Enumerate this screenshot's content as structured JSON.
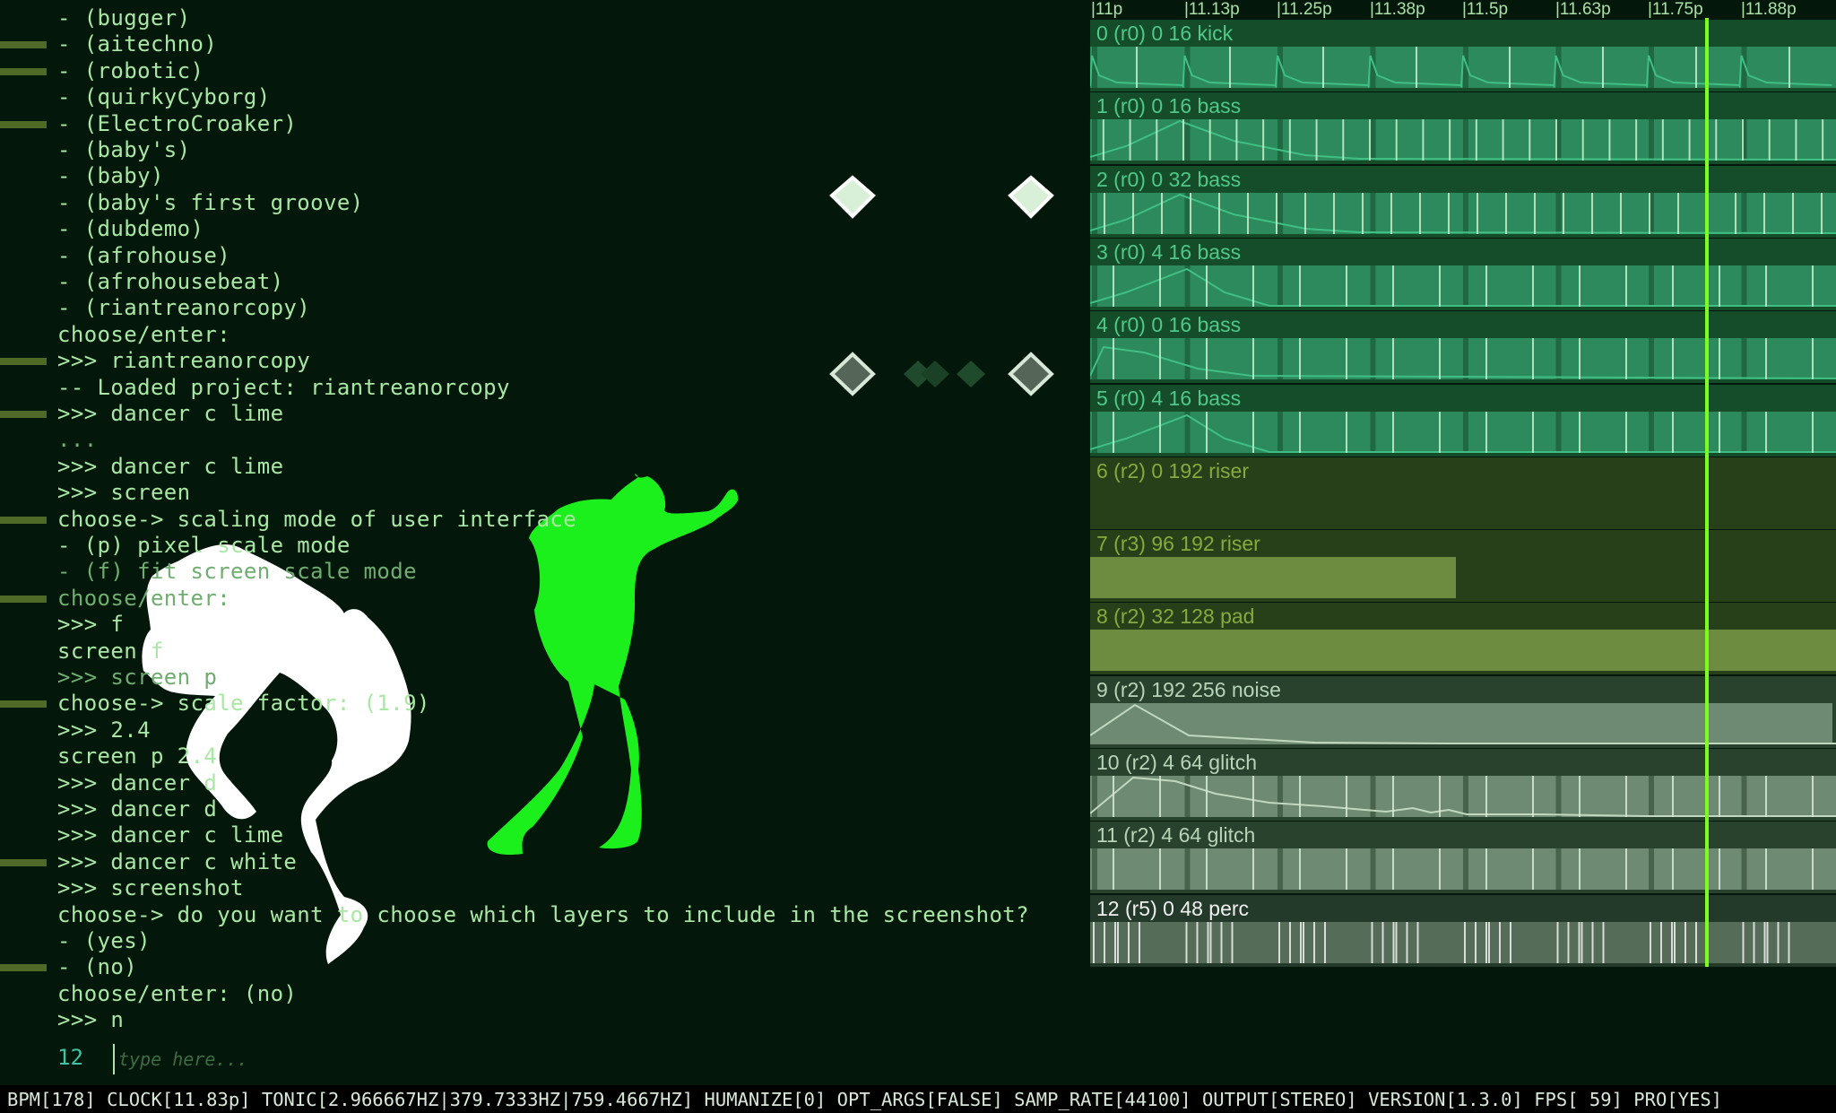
{
  "console": {
    "lines": [
      {
        "text": "- (bugger)",
        "mark": false,
        "dim": false
      },
      {
        "text": "- (aitechno)",
        "mark": true,
        "dim": false
      },
      {
        "text": "- (robotic)",
        "mark": true,
        "dim": false
      },
      {
        "text": "- (quirkyCyborg)",
        "mark": false,
        "dim": false
      },
      {
        "text": "- (ElectroCroaker)",
        "mark": true,
        "dim": false
      },
      {
        "text": "- (baby's)",
        "mark": false,
        "dim": false
      },
      {
        "text": "- (baby)",
        "mark": false,
        "dim": false
      },
      {
        "text": "- (baby's first groove)",
        "mark": false,
        "dim": false
      },
      {
        "text": "- (dubdemo)",
        "mark": false,
        "dim": false
      },
      {
        "text": "- (afrohouse)",
        "mark": false,
        "dim": false
      },
      {
        "text": "- (afrohousebeat)",
        "mark": false,
        "dim": false
      },
      {
        "text": "- (riantreanorcopy)",
        "mark": false,
        "dim": false
      },
      {
        "text": "choose/enter:",
        "mark": false,
        "dim": false
      },
      {
        "text": ">>> riantreanorcopy",
        "mark": true,
        "dim": false
      },
      {
        "text": "-- Loaded project: riantreanorcopy",
        "mark": false,
        "dim": false
      },
      {
        "text": ">>> dancer c lime",
        "mark": true,
        "dim": false
      },
      {
        "text": "...",
        "mark": false,
        "dim": true
      },
      {
        "text": ">>> dancer c lime",
        "mark": false,
        "dim": false
      },
      {
        "text": ">>> screen",
        "mark": false,
        "dim": false
      },
      {
        "text": "choose-> scaling mode of user interface",
        "mark": true,
        "dim": false
      },
      {
        "text": "- (p) pixel scale mode",
        "mark": false,
        "dim": false
      },
      {
        "text": "- (f) fit screen scale mode",
        "mark": false,
        "dim": true
      },
      {
        "text": "choose/enter:",
        "mark": true,
        "dim": true
      },
      {
        "text": ">>> f",
        "mark": false,
        "dim": false
      },
      {
        "text": "screen f",
        "mark": false,
        "dim": false
      },
      {
        "text": ">>> screen p",
        "mark": false,
        "dim": true
      },
      {
        "text": "choose-> scale factor: (1.9)",
        "mark": true,
        "dim": false
      },
      {
        "text": ">>> 2.4",
        "mark": false,
        "dim": false
      },
      {
        "text": "screen p 2.4",
        "mark": false,
        "dim": false
      },
      {
        "text": ">>> dancer d",
        "mark": false,
        "dim": false
      },
      {
        "text": ">>> dancer d",
        "mark": false,
        "dim": false
      },
      {
        "text": ">>> dancer c lime",
        "mark": false,
        "dim": false
      },
      {
        "text": ">>> dancer c white",
        "mark": true,
        "dim": false
      },
      {
        "text": ">>> screenshot",
        "mark": false,
        "dim": false
      },
      {
        "text": "choose-> do you want to choose which layers to include in the screenshot?",
        "mark": false,
        "dim": false
      },
      {
        "text": "- (yes)",
        "mark": false,
        "dim": false
      },
      {
        "text": "- (no)",
        "mark": true,
        "dim": false
      },
      {
        "text": "choose/enter: (no)",
        "mark": false,
        "dim": false
      },
      {
        "text": ">>> n",
        "mark": false,
        "dim": false
      }
    ],
    "prompt_number": "12",
    "prompt_placeholder": "type here..."
  },
  "timeline": {
    "ruler": [
      "|11p",
      "|11.13p",
      "|11.25p",
      "|11.38p",
      "|11.5p",
      "|11.63p",
      "|11.75p",
      "|11.88p"
    ],
    "playhead_fraction": 0.825,
    "tracks": [
      {
        "label": "0 (r0) 0 16 kick",
        "group": "green",
        "fill": 1.0,
        "ticks": 8,
        "wave": "kick"
      },
      {
        "label": "1 (r0) 0 16 bass",
        "group": "green",
        "fill": 1.0,
        "ticks": 28,
        "wave": "bass-long"
      },
      {
        "label": "2 (r0) 0 32 bass",
        "group": "green",
        "fill": 1.0,
        "ticks": 26,
        "wave": "bass-long"
      },
      {
        "label": "3 (r0) 4 16 bass",
        "group": "green",
        "fill": 1.0,
        "ticks": 16,
        "wave": "bass-short"
      },
      {
        "label": "4 (r0) 0 16 bass",
        "group": "green",
        "fill": 1.0,
        "ticks": 16,
        "wave": "bass-decay"
      },
      {
        "label": "5 (r0) 4 16 bass",
        "group": "green",
        "fill": 1.0,
        "ticks": 16,
        "wave": "bass-short"
      },
      {
        "label": "6 (r2) 0 192 riser",
        "group": "olive",
        "fill": 0.0,
        "ticks": 0,
        "wave": "none"
      },
      {
        "label": "7 (r3) 96 192 riser",
        "group": "olive",
        "fill": 0.49,
        "ticks": 0,
        "wave": "none"
      },
      {
        "label": "8 (r2) 32 128 pad",
        "group": "olive",
        "fill": 1.0,
        "ticks": 0,
        "wave": "none"
      },
      {
        "label": "9 (r2) 192 256 noise",
        "group": "gray",
        "fill": 0.995,
        "ticks": 0,
        "wave": "noise"
      },
      {
        "label": "10 (r2) 4 64 glitch",
        "group": "gray",
        "fill": 1.0,
        "ticks": 16,
        "wave": "glitch"
      },
      {
        "label": "11 (r2) 4 64 glitch",
        "group": "gray",
        "fill": 1.0,
        "ticks": 16,
        "wave": "none"
      },
      {
        "label": "12 (r5) 0 48 perc",
        "group": "perc",
        "fill": 1.0,
        "ticks": 48,
        "wave": "none"
      }
    ]
  },
  "colors": {
    "background": "#03180a",
    "console_text": "#a8e8a4",
    "gutter_mark": "#4e6a26",
    "playhead": "#7dff1e",
    "green_header": "#154d2b",
    "green_bar": "#2c8a5c",
    "green_label": "#4fc98a",
    "olive_header": "#28401a",
    "olive_bar": "#6e8c40",
    "olive_label": "#88aa3c",
    "gray_header": "#28422e",
    "gray_bar": "#6f8a72",
    "gray_label": "#b8d4b8",
    "perc_header": "#233a2a",
    "perc_bar": "#556d58",
    "perc_label": "#f0f0f0",
    "dancer_lime": "#1cf01c",
    "dancer_white": "#ffffff"
  },
  "statusbar": {
    "text": "BPM[178] CLOCK[11.83p] TONIC[2.966667HZ|379.7333HZ|759.4667HZ] HUMANIZE[0] OPT_ARGS[FALSE] SAMP_RATE[44100] OUTPUT[STEREO] VERSION[1.3.0] FPS[ 59] PRO[YES]"
  }
}
